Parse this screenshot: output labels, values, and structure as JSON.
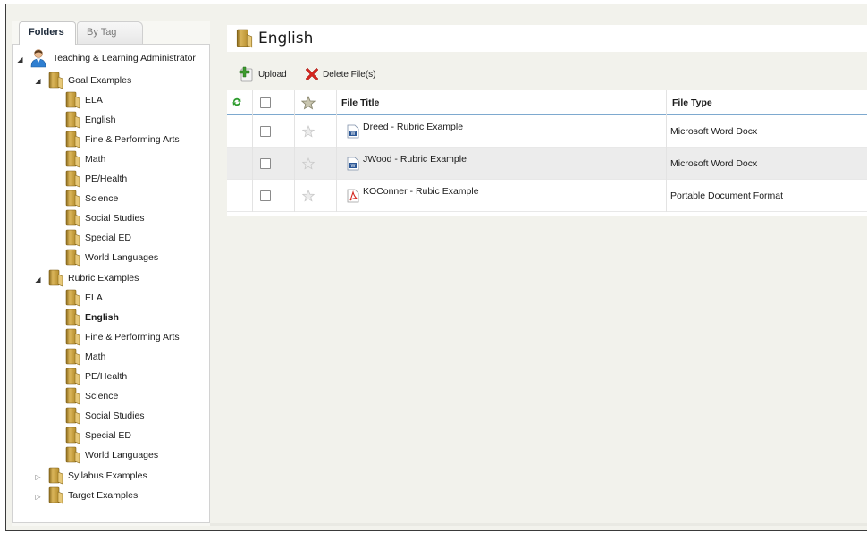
{
  "tabs": {
    "folders": "Folders",
    "by_tag": "By Tag"
  },
  "tree": {
    "root": "Teaching & Learning Administrator",
    "groups": [
      {
        "label": "Goal Examples",
        "expanded": true,
        "children": [
          "ELA",
          "English",
          "Fine & Performing Arts",
          "Math",
          "PE/Health",
          "Science",
          "Social Studies",
          "Special ED",
          "World Languages"
        ]
      },
      {
        "label": "Rubric Examples",
        "expanded": true,
        "children": [
          "ELA",
          "English",
          "Fine & Performing Arts",
          "Math",
          "PE/Health",
          "Science",
          "Social Studies",
          "Special ED",
          "World Languages"
        ],
        "selected": "English"
      },
      {
        "label": "Syllabus Examples",
        "expanded": false,
        "children": []
      },
      {
        "label": "Target Examples",
        "expanded": false,
        "children": []
      }
    ]
  },
  "main": {
    "title": "English",
    "toolbar": {
      "upload": "Upload",
      "delete": "Delete File(s)"
    },
    "columns": {
      "title": "File Title",
      "type": "File Type"
    },
    "files": [
      {
        "title": "Dreed - Rubric Example",
        "type": "Microsoft Word Docx",
        "icon": "word-doc-icon"
      },
      {
        "title": "JWood - Rubric Example",
        "type": "Microsoft Word Docx",
        "icon": "word-doc-icon"
      },
      {
        "title": "KOConner - Rubic Example",
        "type": "Portable Document Format",
        "icon": "pdf-icon"
      }
    ]
  },
  "colors": {
    "folder": "#c9a23f",
    "header_rule": "#7ea9cf",
    "delete_red": "#d4261f",
    "upload_green": "#3d9b2f"
  }
}
